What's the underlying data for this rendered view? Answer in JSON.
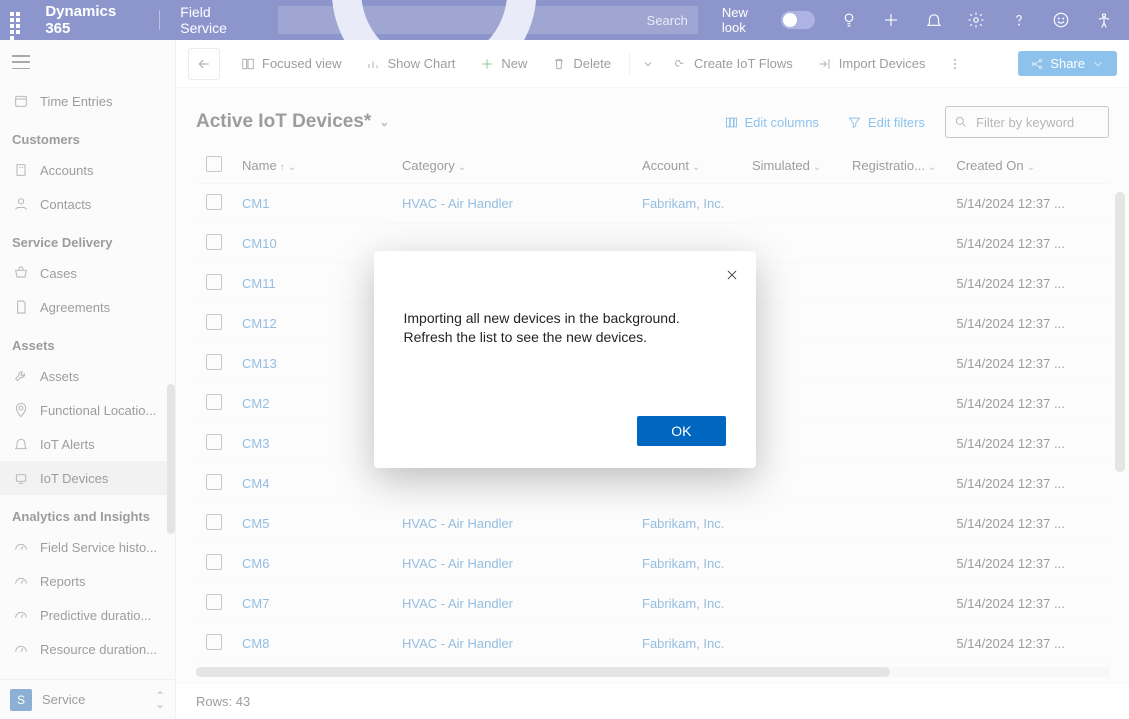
{
  "topbar": {
    "brand": "Dynamics 365",
    "app": "Field Service",
    "search_placeholder": "Search",
    "newlook_label": "New look"
  },
  "nav": {
    "item_time_entries": "Time Entries",
    "section_customers": "Customers",
    "item_accounts": "Accounts",
    "item_contacts": "Contacts",
    "section_service_delivery": "Service Delivery",
    "item_cases": "Cases",
    "item_agreements": "Agreements",
    "section_assets": "Assets",
    "item_assets": "Assets",
    "item_functional_locations": "Functional Locatio...",
    "item_iot_alerts": "IoT Alerts",
    "item_iot_devices": "IoT Devices",
    "section_analytics": "Analytics and Insights",
    "item_fs_history": "Field Service histo...",
    "item_reports": "Reports",
    "item_predictive": "Predictive duratio...",
    "item_resource_duration": "Resource duration...",
    "footer_badge": "S",
    "footer_label": "Service"
  },
  "cmdbar": {
    "focused_view": "Focused view",
    "show_chart": "Show Chart",
    "new": "New",
    "delete": "Delete",
    "create_iot_flows": "Create IoT Flows",
    "import_devices": "Import Devices",
    "share": "Share"
  },
  "view": {
    "title": "Active IoT Devices*",
    "edit_columns": "Edit columns",
    "edit_filters": "Edit filters",
    "filter_placeholder": "Filter by keyword"
  },
  "grid": {
    "headers": {
      "name": "Name",
      "category": "Category",
      "account": "Account",
      "simulated": "Simulated",
      "registration": "Registratio...",
      "created_on": "Created On"
    },
    "rows": [
      {
        "name": "CM1",
        "category": "HVAC - Air Handler",
        "account": "Fabrikam, Inc.",
        "created": "5/14/2024 12:37 ..."
      },
      {
        "name": "CM10",
        "category": "",
        "account": "",
        "created": "5/14/2024 12:37 ..."
      },
      {
        "name": "CM11",
        "category": "",
        "account": "",
        "created": "5/14/2024 12:37 ..."
      },
      {
        "name": "CM12",
        "category": "",
        "account": "",
        "created": "5/14/2024 12:37 ..."
      },
      {
        "name": "CM13",
        "category": "",
        "account": "",
        "created": "5/14/2024 12:37 ..."
      },
      {
        "name": "CM2",
        "category": "",
        "account": "",
        "created": "5/14/2024 12:37 ..."
      },
      {
        "name": "CM3",
        "category": "",
        "account": "",
        "created": "5/14/2024 12:37 ..."
      },
      {
        "name": "CM4",
        "category": "",
        "account": "",
        "created": "5/14/2024 12:37 ..."
      },
      {
        "name": "CM5",
        "category": "HVAC - Air Handler",
        "account": "Fabrikam, Inc.",
        "created": "5/14/2024 12:37 ..."
      },
      {
        "name": "CM6",
        "category": "HVAC - Air Handler",
        "account": "Fabrikam, Inc.",
        "created": "5/14/2024 12:37 ..."
      },
      {
        "name": "CM7",
        "category": "HVAC - Air Handler",
        "account": "Fabrikam, Inc.",
        "created": "5/14/2024 12:37 ..."
      },
      {
        "name": "CM8",
        "category": "HVAC - Air Handler",
        "account": "Fabrikam, Inc.",
        "created": "5/14/2024 12:37 ..."
      }
    ],
    "rowcount_label": "Rows: 43"
  },
  "modal": {
    "message": "Importing all new devices in the background. Refresh the list to see the new devices.",
    "ok": "OK"
  }
}
